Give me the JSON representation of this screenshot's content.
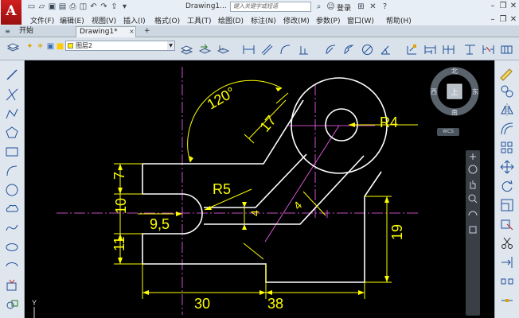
{
  "title_bar": {
    "logo_letter": "A",
    "drawing_name": "Drawing1...",
    "search_placeholder": "键入关键字或短语",
    "login_label": "登录"
  },
  "menu": [
    "文件(F)",
    "编辑(E)",
    "视图(V)",
    "插入(I)",
    "格式(O)",
    "工具(T)",
    "绘图(D)",
    "标注(N)",
    "修改(M)",
    "参数(P)",
    "窗口(W)",
    "帮助(H)"
  ],
  "tabs": {
    "start": "开始",
    "drawing": "Drawing1*",
    "add": "+"
  },
  "layer": {
    "name": "图层2",
    "color": "#ffee00"
  },
  "viewcube": {
    "north": "北",
    "south": "南",
    "east": "东",
    "west": "西",
    "top": "上",
    "wcs": "WCS"
  },
  "ucs": {
    "axis_y": "Y"
  },
  "dimensions": {
    "angle": "120°",
    "d17": "17",
    "r4": "R4",
    "r5": "R5",
    "d7": "7",
    "d10": "10",
    "d9_5": "9,5",
    "d4a": "4",
    "d4b": "4",
    "d11": "11",
    "d19": "19",
    "d30": "30",
    "d38": "38"
  },
  "colors": {
    "dimension": "#ffff00",
    "object": "#ffffff",
    "centerline": "#ff66ff",
    "canvas": "#000000"
  }
}
